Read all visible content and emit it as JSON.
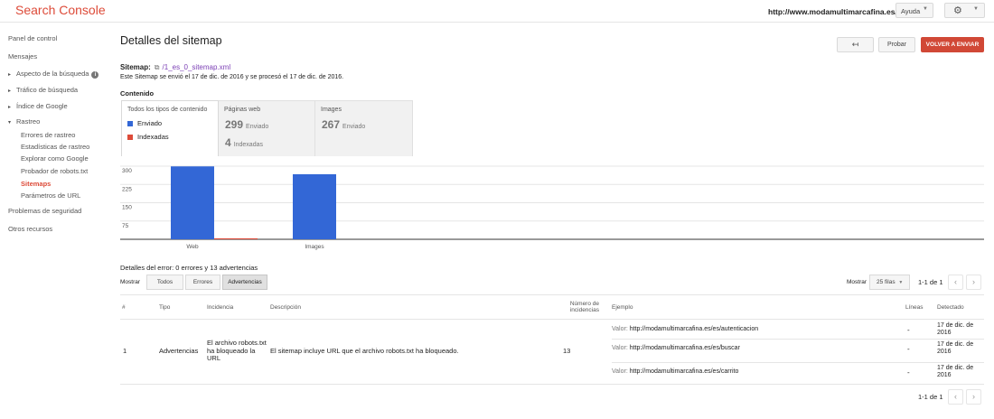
{
  "header": {
    "app_title": "Search Console",
    "site_url": "http://www.modamultimarcafina.es/",
    "help_label": "Ayuda",
    "help_caret": "▼",
    "gear_glyph": "⚙",
    "gear_caret": "▼"
  },
  "sidebar": {
    "items": [
      {
        "label": "Panel de control"
      },
      {
        "label": "Mensajes"
      },
      {
        "label": "Aspecto de la búsqueda",
        "arrow": "▸",
        "info": "i"
      },
      {
        "label": "Tráfico de búsqueda",
        "arrow": "▸"
      },
      {
        "label": "Índice de Google",
        "arrow": "▸"
      },
      {
        "label": "Rastreo",
        "arrow": "▾"
      },
      {
        "label": "Problemas de seguridad"
      },
      {
        "label": "Otros recursos"
      }
    ],
    "rastreo_sub": [
      {
        "label": "Errores de rastreo"
      },
      {
        "label": "Estadísticas de rastreo"
      },
      {
        "label": "Explorar como Google"
      },
      {
        "label": "Probador de robots.txt"
      },
      {
        "label": "Sitemaps",
        "active": true
      },
      {
        "label": "Parámetros de URL"
      }
    ]
  },
  "main": {
    "title": "Detalles del sitemap",
    "back_glyph": "↤",
    "test_label": "Probar",
    "resubmit_label": "VOLVER A ENVIAR",
    "sitemap_label": "Sitemap:",
    "ext_glyph": "⧉",
    "sitemap_link": "/1_es_0_sitemap.xml",
    "sitemap_info": "Este Sitemap se envió el 17 de dic. de 2016 y se procesó el 17 de dic. de 2016.",
    "content_label": "Contenido"
  },
  "content_tabs": {
    "all": {
      "title": "Todos los tipos de contenido",
      "legend_sent": "Enviado",
      "legend_indexed": "Indexadas"
    },
    "web": {
      "title": "Páginas web",
      "sent_num": "299",
      "sent_lbl": "Enviado",
      "idx_num": "4",
      "idx_lbl": "Indexadas"
    },
    "images": {
      "title": "Images",
      "sent_num": "267",
      "sent_lbl": "Enviado"
    }
  },
  "colors": {
    "sent": "#3367d6",
    "indexed": "#dd4b39",
    "accent": "#dd4b39"
  },
  "chart_data": {
    "type": "bar",
    "categories": [
      "Web",
      "Images"
    ],
    "series": [
      {
        "name": "Enviado",
        "values": [
          299,
          267
        ]
      },
      {
        "name": "Indexadas",
        "values": [
          4,
          0
        ]
      }
    ],
    "yticks": [
      "300",
      "225",
      "150",
      "75"
    ],
    "ylim": [
      0,
      300
    ],
    "grid": true
  },
  "errors": {
    "title": "Detalles del error: 0 errores y 13 advertencias",
    "show_label": "Mostrar",
    "filters": [
      "Todos",
      "Errores",
      "Advertencias"
    ],
    "active_filter": "Advertencias",
    "rows_label": "Mostrar",
    "rows_value": "25 filas",
    "rows_caret": "▼",
    "page_info": "1-1 de 1",
    "prev_glyph": "‹",
    "next_glyph": "›",
    "columns": {
      "num": "#",
      "type": "Tipo",
      "issue": "Incidencia",
      "desc": "Descripción",
      "count": "Número de incidencias",
      "example": "Ejemplo",
      "lines": "Líneas",
      "detected": "Detectado"
    },
    "row": {
      "num": "1",
      "type": "Advertencias",
      "issue": "El archivo robots.txt ha bloqueado la URL",
      "desc": "El sitemap incluye URL que el archivo robots.txt ha bloqueado.",
      "count": "13",
      "examples": [
        {
          "prefix": "Valor:",
          "url": "http://modamultimarcafina.es/es/autenticacion",
          "lines": "-",
          "date": "17 de dic. de 2016"
        },
        {
          "prefix": "Valor:",
          "url": "http://modamultimarcafina.es/es/buscar",
          "lines": "-",
          "date": "17 de dic. de 2016"
        },
        {
          "prefix": "Valor:",
          "url": "http://modamultimarcafina.es/es/carrito",
          "lines": "-",
          "date": "17 de dic. de 2016"
        }
      ]
    }
  }
}
